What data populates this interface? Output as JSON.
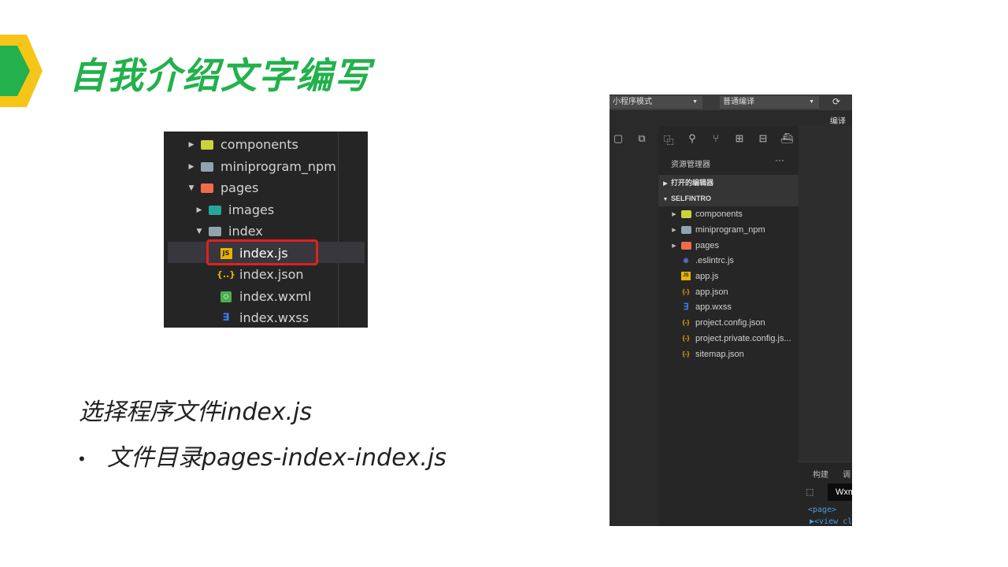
{
  "slide": {
    "title": "自我介绍文字编写",
    "line1": "选择程序文件index.js",
    "bullet": "文件目录pages-index-index.js",
    "bullet_mark": "•",
    "accent_green": "#22b14c",
    "accent_yellow": "#f5c518"
  },
  "tree_small": {
    "items": [
      {
        "label": "components",
        "icon": "components-folder-icon",
        "arrow": "▶"
      },
      {
        "label": "miniprogram_npm",
        "icon": "folder-icon",
        "arrow": "▶"
      },
      {
        "label": "pages",
        "icon": "pages-folder-icon",
        "arrow": "▼"
      },
      {
        "label": "images",
        "icon": "images-folder-icon",
        "arrow": "▶"
      },
      {
        "label": "index",
        "icon": "open-folder-icon",
        "arrow": "▼"
      },
      {
        "label": "index.js",
        "icon": "js-file-icon",
        "badge": "JS",
        "selected": true
      },
      {
        "label": "index.json",
        "icon": "json-file-icon",
        "badge": "{..}"
      },
      {
        "label": "index.wxml",
        "icon": "wxml-file-icon",
        "badge": "◇"
      },
      {
        "label": "index.wxss",
        "icon": "wxss-file-icon",
        "badge": "∃"
      }
    ]
  },
  "ide": {
    "mode_select": "小程序模式",
    "compile_select": "普通编译",
    "compile_label": "编译",
    "refresh_glyph": "⟳",
    "toolbar_glyphs": [
      "▢",
      "⧉",
      "⿻",
      "⚲",
      "⑂",
      "⊞",
      "⊟",
      "⛴"
    ],
    "explorer_title": "资源管理器",
    "more_glyph": "···",
    "open_editors": "打开的编辑器",
    "project_name": "SELFINTRO",
    "files": [
      {
        "label": "components",
        "icon": "components-folder-icon",
        "arrow": "▶"
      },
      {
        "label": "miniprogram_npm",
        "icon": "folder-icon",
        "arrow": "▶"
      },
      {
        "label": "pages",
        "icon": "pages-folder-icon",
        "arrow": "▶"
      },
      {
        "label": ".eslintrc.js",
        "icon": "eslint-file-icon",
        "badge": "◉"
      },
      {
        "label": "app.js",
        "icon": "js-file-icon",
        "badge": "JS"
      },
      {
        "label": "app.json",
        "icon": "json-file-icon",
        "badge": "{-}"
      },
      {
        "label": "app.wxss",
        "icon": "wxss-file-icon",
        "badge": "∃"
      },
      {
        "label": "project.config.json",
        "icon": "json-file-icon",
        "badge": "{-}"
      },
      {
        "label": "project.private.config.js...",
        "icon": "json-file-icon",
        "badge": "{-}"
      },
      {
        "label": "sitemap.json",
        "icon": "json-file-icon",
        "badge": "{-}"
      }
    ],
    "bottom_tab_build": "构建",
    "bottom_tab_debug": "调",
    "wxml_tab": "Wxm",
    "code_line1": "<page>",
    "code_line2": "▶<view cl"
  }
}
